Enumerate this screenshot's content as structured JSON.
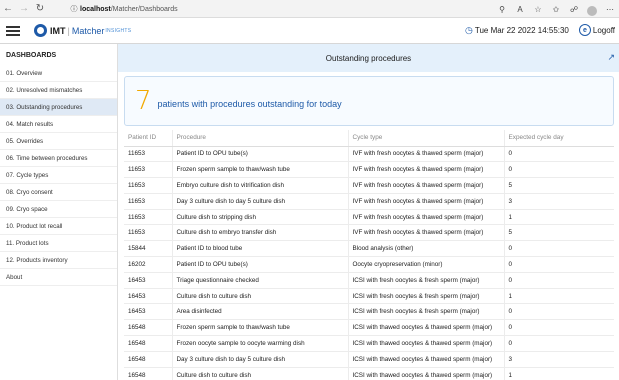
{
  "browser": {
    "host": "localhost",
    "path": "/Matcher/Dashboards"
  },
  "header": {
    "brand": "IMT",
    "product": "Matcher",
    "product_sub": "INSIGHTS",
    "datetime": "Tue Mar 22 2022 14:55:30",
    "logoff_label": "Logoff"
  },
  "sidebar": {
    "title": "DASHBOARDS",
    "items": [
      {
        "label": "01. Overview",
        "active": false
      },
      {
        "label": "02. Unresolved mismatches",
        "active": false
      },
      {
        "label": "03. Outstanding procedures",
        "active": true
      },
      {
        "label": "04. Match results",
        "active": false
      },
      {
        "label": "05. Overrides",
        "active": false
      },
      {
        "label": "06. Time between procedures",
        "active": false
      },
      {
        "label": "07. Cycle types",
        "active": false
      },
      {
        "label": "08. Cryo consent",
        "active": false
      },
      {
        "label": "09. Cryo space",
        "active": false
      },
      {
        "label": "10. Product lot recall",
        "active": false
      },
      {
        "label": "11. Product lots",
        "active": false
      },
      {
        "label": "12. Products inventory",
        "active": false
      },
      {
        "label": "About",
        "active": false
      }
    ]
  },
  "main": {
    "title": "Outstanding procedures",
    "summary": {
      "count": "7",
      "text": "patients with procedures outstanding for today"
    },
    "table": {
      "headers": [
        "Patient ID",
        "Procedure",
        "Cycle type",
        "Expected cycle day"
      ],
      "rows": [
        [
          "11653",
          "Patient ID to OPU tube(s)",
          "IVF with fresh oocytes & thawed sperm (major)",
          "0"
        ],
        [
          "11653",
          "Frozen sperm sample to thaw/wash tube",
          "IVF with fresh oocytes & thawed sperm (major)",
          "0"
        ],
        [
          "11653",
          "Embryo culture dish to vitrification dish",
          "IVF with fresh oocytes & thawed sperm (major)",
          "5"
        ],
        [
          "11653",
          "Day 3 culture dish to day 5 culture dish",
          "IVF with fresh oocytes & thawed sperm (major)",
          "3"
        ],
        [
          "11653",
          "Culture dish to stripping dish",
          "IVF with fresh oocytes & thawed sperm (major)",
          "1"
        ],
        [
          "11653",
          "Culture dish to embryo transfer dish",
          "IVF with fresh oocytes & thawed sperm (major)",
          "5"
        ],
        [
          "15844",
          "Patient ID to blood tube",
          "Blood analysis (other)",
          "0"
        ],
        [
          "16202",
          "Patient ID to OPU tube(s)",
          "Oocyte cryopreservation (minor)",
          "0"
        ],
        [
          "16453",
          "Triage questionnaire checked",
          "ICSI with fresh oocytes & fresh sperm (major)",
          "0"
        ],
        [
          "16453",
          "Culture dish to culture dish",
          "ICSI with fresh oocytes & fresh sperm (major)",
          "1"
        ],
        [
          "16453",
          "Area disinfected",
          "ICSI with fresh oocytes & fresh sperm (major)",
          "0"
        ],
        [
          "16548",
          "Frozen sperm sample to thaw/wash tube",
          "ICSI with thawed oocytes & thawed sperm (major)",
          "0"
        ],
        [
          "16548",
          "Frozen oocyte sample to oocyte warming dish",
          "ICSI with thawed oocytes & thawed sperm (major)",
          "0"
        ],
        [
          "16548",
          "Day 3 culture dish to day 5 culture dish",
          "ICSI with thawed oocytes & thawed sperm (major)",
          "3"
        ],
        [
          "16548",
          "Culture dish to culture dish",
          "ICSI with thawed oocytes & thawed sperm (major)",
          "1"
        ]
      ]
    }
  }
}
